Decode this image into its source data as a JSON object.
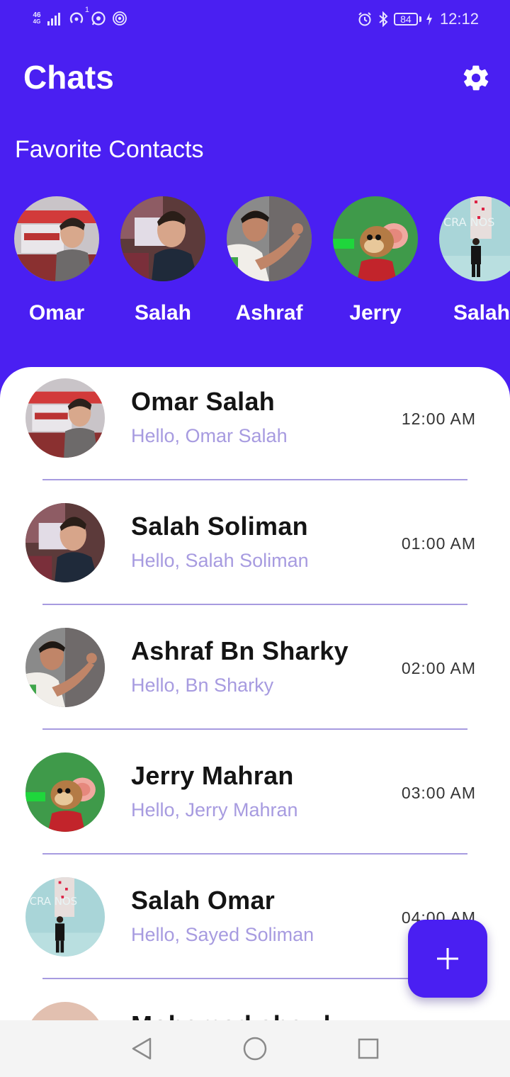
{
  "status_bar": {
    "network_label": "46",
    "network_label_2": "4G",
    "hotspot_count": "1",
    "battery": "84",
    "time": "12:12"
  },
  "header": {
    "title": "Chats",
    "settings_icon": "gear-icon"
  },
  "favorites": {
    "heading": "Favorite Contacts",
    "items": [
      {
        "name": "Omar"
      },
      {
        "name": "Salah"
      },
      {
        "name": "Ashraf"
      },
      {
        "name": "Jerry"
      },
      {
        "name": "Salah"
      }
    ]
  },
  "chats": [
    {
      "name": "Omar Salah",
      "preview": "Hello, Omar Salah",
      "time": "12:00 AM"
    },
    {
      "name": "Salah Soliman",
      "preview": "Hello, Salah Soliman",
      "time": "01:00 AM"
    },
    {
      "name": "Ashraf Bn Sharky",
      "preview": "Hello, Bn Sharky",
      "time": "02:00 AM"
    },
    {
      "name": "Jerry Mahran",
      "preview": "Hello, Jerry Mahran",
      "time": "03:00 AM"
    },
    {
      "name": "Salah Omar",
      "preview": "Hello, Sayed Soliman",
      "time": "04:00 AM"
    },
    {
      "name": "Mohamed shawky",
      "preview": "",
      "time": ""
    }
  ],
  "fab": {
    "icon": "plus-icon"
  },
  "nav": {
    "back_icon": "back-triangle-icon",
    "home_icon": "home-circle-icon",
    "recents_icon": "recents-square-icon"
  },
  "colors": {
    "primary": "#4a1ff2",
    "preview_text": "#a79be0",
    "divider": "#a79be0",
    "panel": "#ffffff"
  }
}
